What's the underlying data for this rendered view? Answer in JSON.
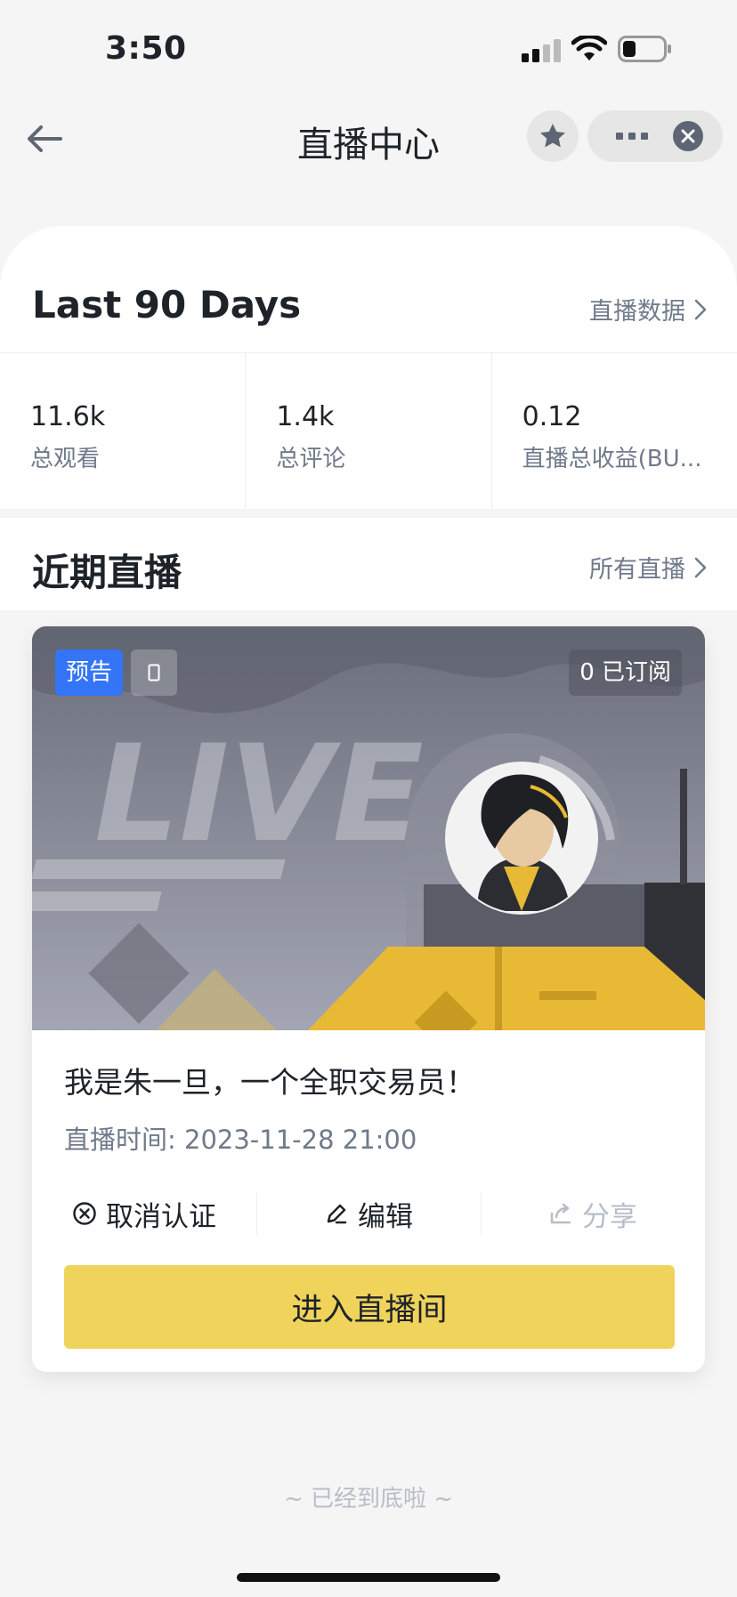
{
  "status_bar": {
    "time": "3:50"
  },
  "nav": {
    "title": "直播中心"
  },
  "summary": {
    "title": "Last 90 Days",
    "link": "直播数据",
    "stats": [
      {
        "value": "11.6k",
        "label": "总观看"
      },
      {
        "value": "1.4k",
        "label": "总评论"
      },
      {
        "value": "0.12",
        "label": "直播总收益(BU..."
      }
    ]
  },
  "recent": {
    "title": "近期直播",
    "link": "所有直播"
  },
  "live_card": {
    "tag_preview": "预告",
    "subscribers": "0 已订阅",
    "cover_text": "LIVE",
    "title": "我是朱一旦，一个全职交易员！",
    "time": "直播时间: 2023-11-28 21:00",
    "actions": {
      "cancel": "取消认证",
      "edit": "编辑",
      "share": "分享"
    },
    "enter_button": "进入直播间"
  },
  "footer": {
    "tip": "~ 已经到底啦 ~"
  },
  "colors": {
    "accent": "#F0D35B",
    "tag_blue": "#3375F6",
    "text_primary": "#1E2329",
    "text_secondary": "#707A8A"
  }
}
